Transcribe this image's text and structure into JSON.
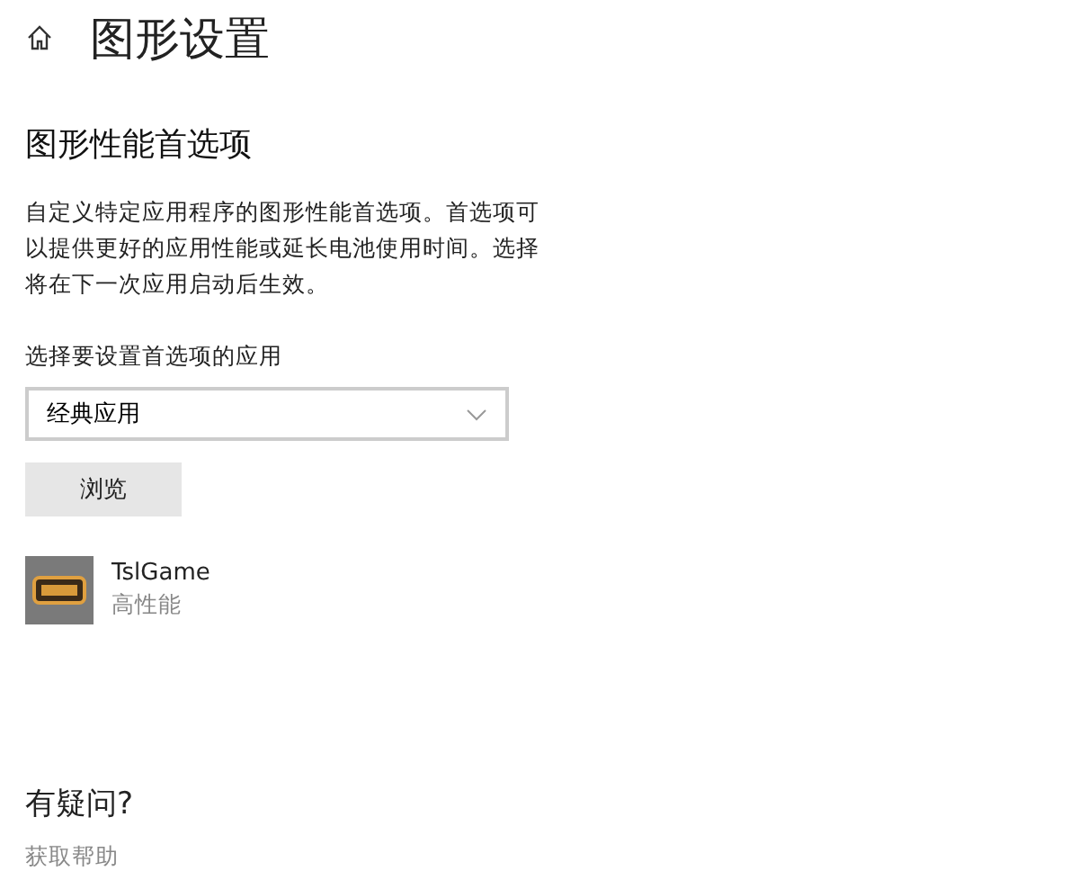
{
  "page": {
    "title": "图形设置"
  },
  "section": {
    "heading": "图形性能首选项",
    "description": "自定义特定应用程序的图形性能首选项。首选项可以提供更好的应用性能或延长电池使用时间。选择将在下一次应用启动后生效。"
  },
  "app_picker": {
    "label": "选择要设置首选项的应用",
    "value": "经典应用",
    "browse_button": "浏览"
  },
  "apps": [
    {
      "name": "TslGame",
      "preference": "高性能"
    }
  ],
  "help": {
    "heading": "有疑问?",
    "link": "获取帮助"
  }
}
